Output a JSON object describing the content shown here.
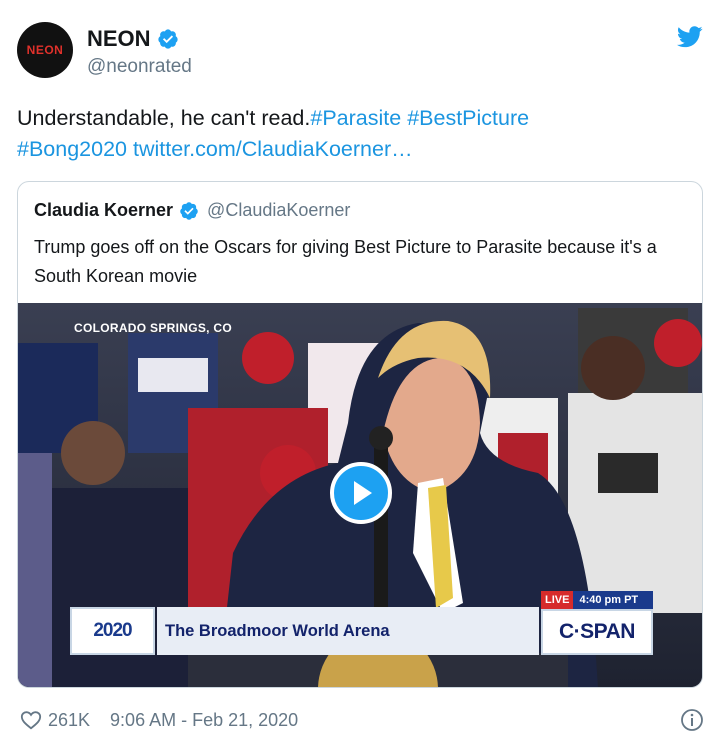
{
  "author": {
    "avatar_text": "NEON",
    "display_name": "NEON",
    "handle": "@neonrated"
  },
  "tweet": {
    "text_plain": "Understandable, he can't read.",
    "hashtags": [
      "#Parasite",
      "#BestPicture",
      "#Bong2020"
    ],
    "link": "twitter.com/ClaudiaKoerner…"
  },
  "quote": {
    "display_name": "Claudia Koerner",
    "handle": "@ClaudiaKoerner",
    "text": "Trump goes off on the Oscars for giving Best Picture to Parasite because it's a South Korean movie"
  },
  "video": {
    "location": "COLORADO SPRINGS, CO",
    "logo_text": "2020",
    "venue": "The Broadmoor World Arena",
    "live_label": "LIVE",
    "live_time": "4:40 pm PT",
    "network": "C·SPAN"
  },
  "footer": {
    "likes": "261K",
    "timestamp": "9:06 AM - Feb 21, 2020"
  },
  "colors": {
    "link": "#1b95e0",
    "twitter_blue": "#1da1f2",
    "secondary_text": "#657786"
  },
  "icons": [
    "verified-badge-icon",
    "twitter-bird-icon",
    "play-icon",
    "heart-icon",
    "info-icon"
  ]
}
